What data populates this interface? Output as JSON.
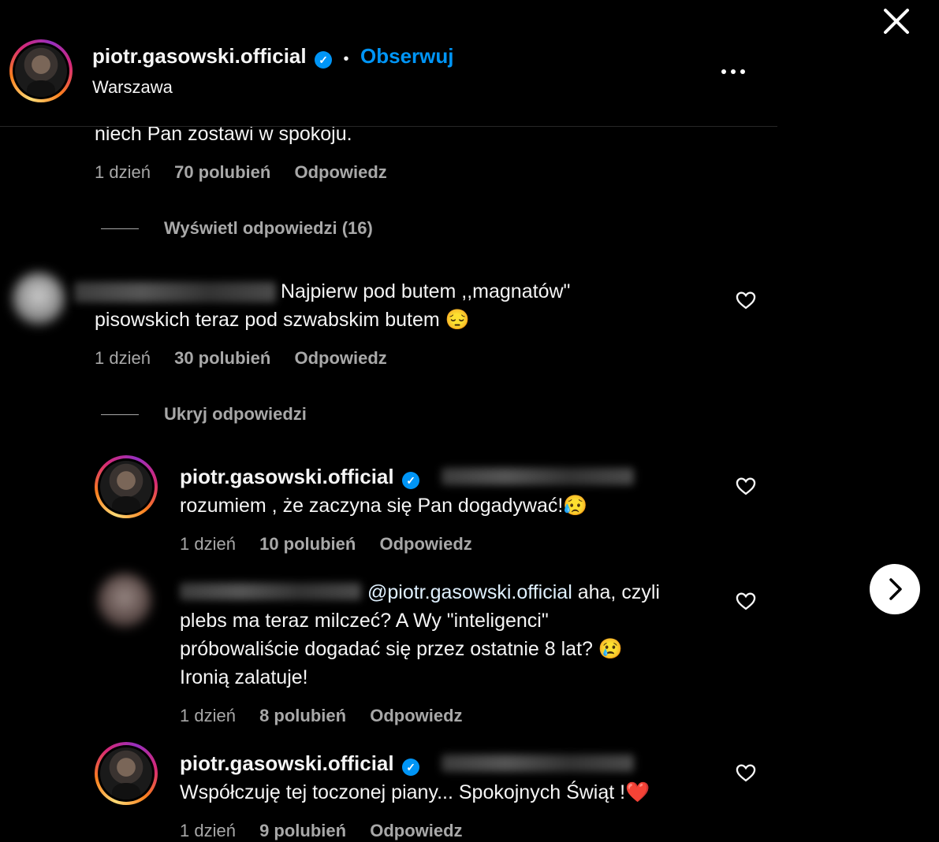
{
  "header": {
    "username": "piotr.gasowski.official",
    "separator": "•",
    "follow_label": "Obserwuj",
    "location": "Warszawa",
    "more_label": "•••"
  },
  "close_label": "✕",
  "comments": [
    {
      "text": "niech Pan zostawi w spokoju.",
      "time": "1 dzień",
      "likes": "70 polubień",
      "reply": "Odpowiedz",
      "replies_toggle": "Wyświetl odpowiedzi (16)"
    },
    {
      "text_line1": "Najpierw pod butem ,,magnatów\"",
      "text_line2": "pisowskich teraz pod szwabskim butem 😔",
      "time": "1 dzień",
      "likes": "30 polubień",
      "reply": "Odpowiedz",
      "replies_toggle": "Ukryj odpowiedzi"
    }
  ],
  "replies": [
    {
      "username": "piotr.gasowski.official",
      "text": "rozumiem , że zaczyna się Pan dogadywać!😥",
      "time": "1 dzień",
      "likes": "10 polubień",
      "reply": "Odpowiedz"
    },
    {
      "mention": "@piotr.gasowski.official",
      "text_line1_rest": " aha, czyli",
      "text_line2": "plebs ma teraz milczeć? A Wy \"inteligenci\"",
      "text_line3": "próbowaliście dogadać się przez ostatnie 8 lat? 😢",
      "text_line4": "Ironią zalatuje!",
      "time": "1 dzień",
      "likes": "8 polubień",
      "reply": "Odpowiedz"
    },
    {
      "username": "piotr.gasowski.official",
      "text": "Współczuję tej toczonej piany... Spokojnych Świąt !❤️",
      "time": "1 dzień",
      "likes": "9 polubień",
      "reply": "Odpowiedz"
    }
  ],
  "icons": {
    "close": "close-icon",
    "verified": "verified-badge-icon",
    "heart": "heart-icon",
    "more": "more-options-icon",
    "next": "chevron-right-icon"
  },
  "colors": {
    "background": "#000000",
    "link_blue": "#0095f6",
    "muted": "#a8a8a8"
  }
}
